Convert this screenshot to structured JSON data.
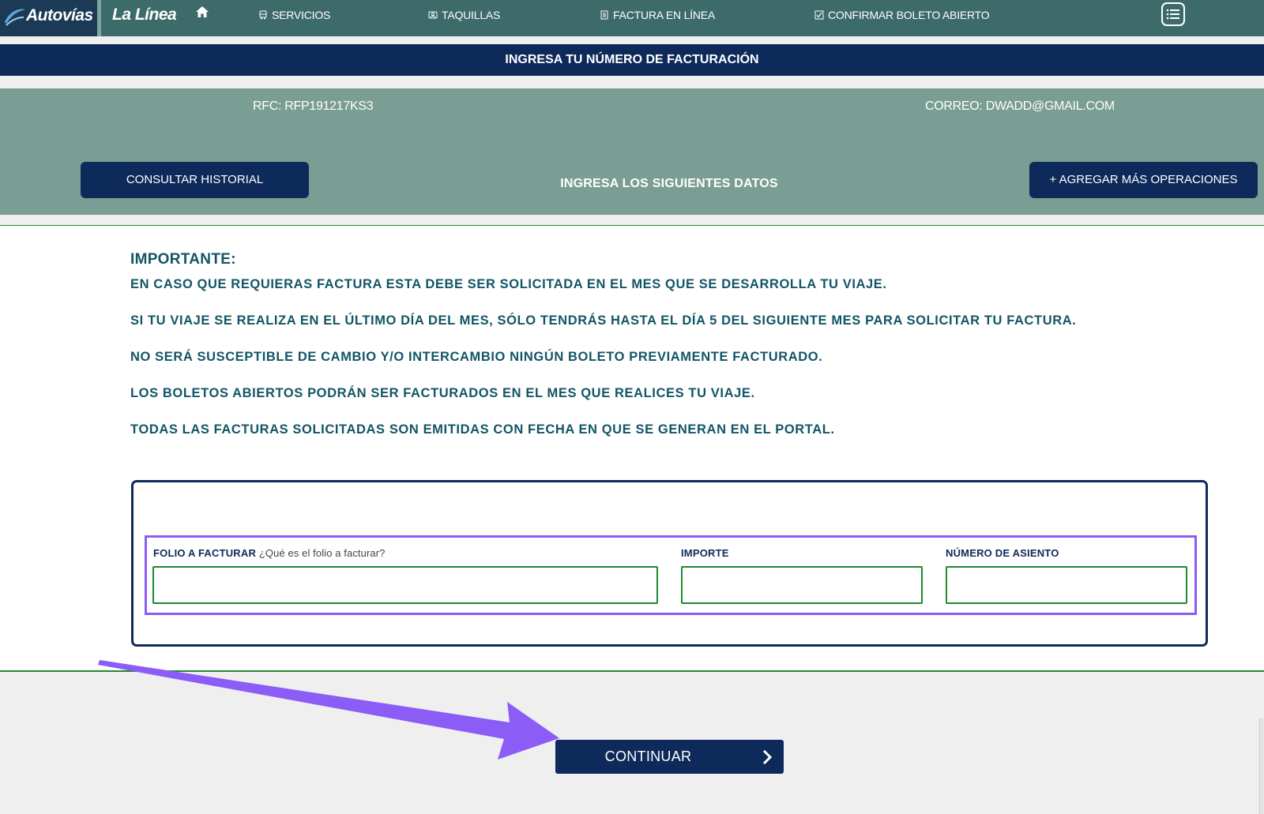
{
  "nav": {
    "brand_primary": "Autovías",
    "brand_secondary": "La Línea",
    "items": [
      {
        "label": "SERVICIOS",
        "icon": "bus-icon"
      },
      {
        "label": "TAQUILLAS",
        "icon": "ticket-office-icon"
      },
      {
        "label": "FACTURA EN LÍNEA",
        "icon": "invoice-icon"
      },
      {
        "label": "CONFIRMAR BOLETO ABIERTO",
        "icon": "checkbox-icon"
      }
    ],
    "home_icon": "home-icon",
    "menu_icon": "list-menu-icon"
  },
  "title_bar": "INGRESA TU NÚMERO DE FACTURACIÓN",
  "info": {
    "rfc": "RFC: RFP191217KS3",
    "correo": "CORREO: DWADD@GMAIL.COM",
    "history_button": "CONSULTAR HISTORIAL",
    "instruction": "INGRESA LOS SIGUIENTES DATOS",
    "add_button": "+ AGREGAR MÁS OPERACIONES"
  },
  "notice": {
    "title": "IMPORTANTE:",
    "lines": [
      "EN CASO QUE REQUIERAS FACTURA ESTA DEBE SER SOLICITADA EN EL MES QUE SE DESARROLLA TU VIAJE.",
      "SI TU VIAJE SE REALIZA EN EL ÚLTIMO DÍA DEL MES, SÓLO TENDRÁS HASTA EL DÍA 5 DEL SIGUIENTE MES PARA SOLICITAR TU FACTURA.",
      "NO SERÁ SUSCEPTIBLE DE CAMBIO Y/O INTERCAMBIO NINGÚN BOLETO PREVIAMENTE FACTURADO.",
      "LOS BOLETOS ABIERTOS PODRÁN SER FACTURADOS EN EL MES QUE REALICES TU VIAJE.",
      "TODAS LAS FACTURAS SOLICITADAS SON EMITIDAS CON FECHA EN QUE SE GENERAN EN EL PORTAL."
    ]
  },
  "form": {
    "folio_label": "FOLIO A FACTURAR",
    "folio_help": "¿Qué es el folio a facturar?",
    "folio_value": "",
    "importe_label": "IMPORTE",
    "importe_value": "",
    "asiento_label": "NÚMERO DE ASIENTO",
    "asiento_value": ""
  },
  "footer": {
    "continue_button": "CONTINUAR",
    "continue_icon": "chevron-right-icon"
  },
  "colors": {
    "nav_bg": "#3d6b6a",
    "navy": "#0e2a5a",
    "panel_bg": "#7a9e93",
    "notice_text": "#125566",
    "highlight": "#8b5cf6",
    "input_border": "#1f8a2e"
  }
}
